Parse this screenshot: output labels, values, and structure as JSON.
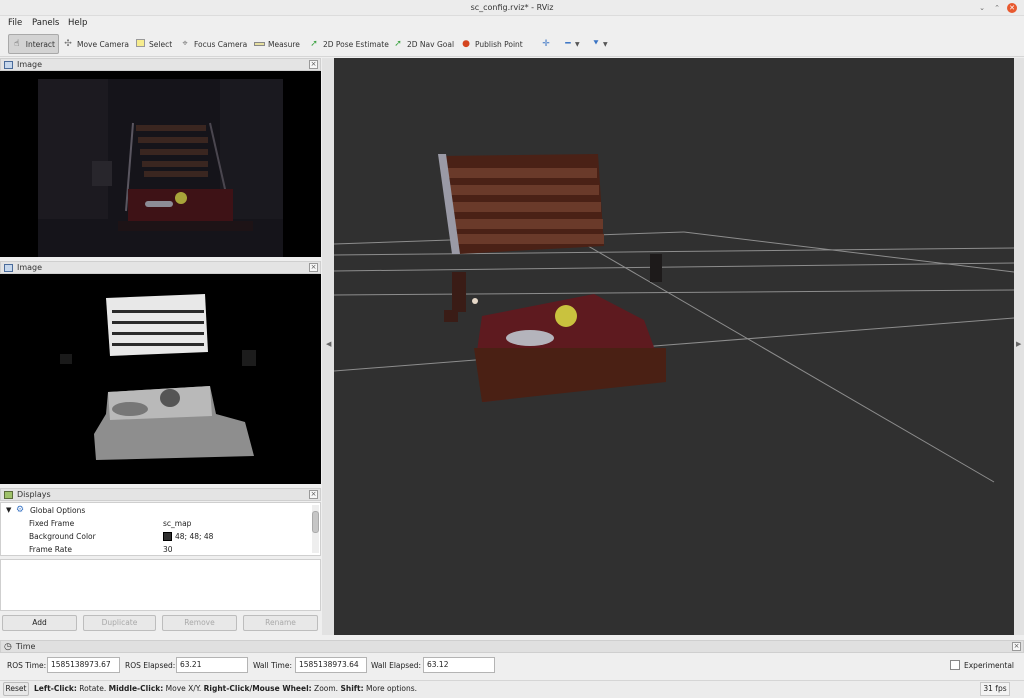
{
  "window": {
    "title": "sc_config.rviz* - RViz"
  },
  "menu": [
    "File",
    "Panels",
    "Help"
  ],
  "toolbar": {
    "interact": "Interact",
    "move_camera": "Move Camera",
    "select": "Select",
    "focus_camera": "Focus Camera",
    "measure": "Measure",
    "pose_estimate": "2D Pose Estimate",
    "nav_goal": "2D Nav Goal",
    "publish_point": "Publish Point"
  },
  "image_panel_1": {
    "title": "Image"
  },
  "image_panel_2": {
    "title": "Image"
  },
  "displays": {
    "title": "Displays",
    "global_options": "Global Options",
    "rows": [
      {
        "name": "Fixed Frame",
        "value": "sc_map"
      },
      {
        "name": "Background Color",
        "value": "48; 48; 48"
      },
      {
        "name": "Frame Rate",
        "value": "30"
      }
    ],
    "buttons": {
      "add": "Add",
      "duplicate": "Duplicate",
      "remove": "Remove",
      "rename": "Rename"
    }
  },
  "time": {
    "title": "Time",
    "ros_time_label": "ROS Time:",
    "ros_time": "1585138973.67",
    "ros_elapsed_label": "ROS Elapsed:",
    "ros_elapsed": "63.21",
    "wall_time_label": "Wall Time:",
    "wall_time": "1585138973.64",
    "wall_elapsed_label": "Wall Elapsed:",
    "wall_elapsed": "63.12",
    "experimental": "Experimental"
  },
  "status": {
    "reset": "Reset",
    "left_click": "Left-Click:",
    "left_text": " Rotate. ",
    "middle_click": "Middle-Click:",
    "middle_text": " Move X/Y. ",
    "right_click": "Right-Click/Mouse Wheel:",
    "right_text": " Zoom. ",
    "shift": "Shift:",
    "shift_text": " More options.",
    "fps": "31 fps"
  },
  "colors": {
    "background": "#303030",
    "accent": "#3a74c4",
    "close": "#e8592f"
  }
}
